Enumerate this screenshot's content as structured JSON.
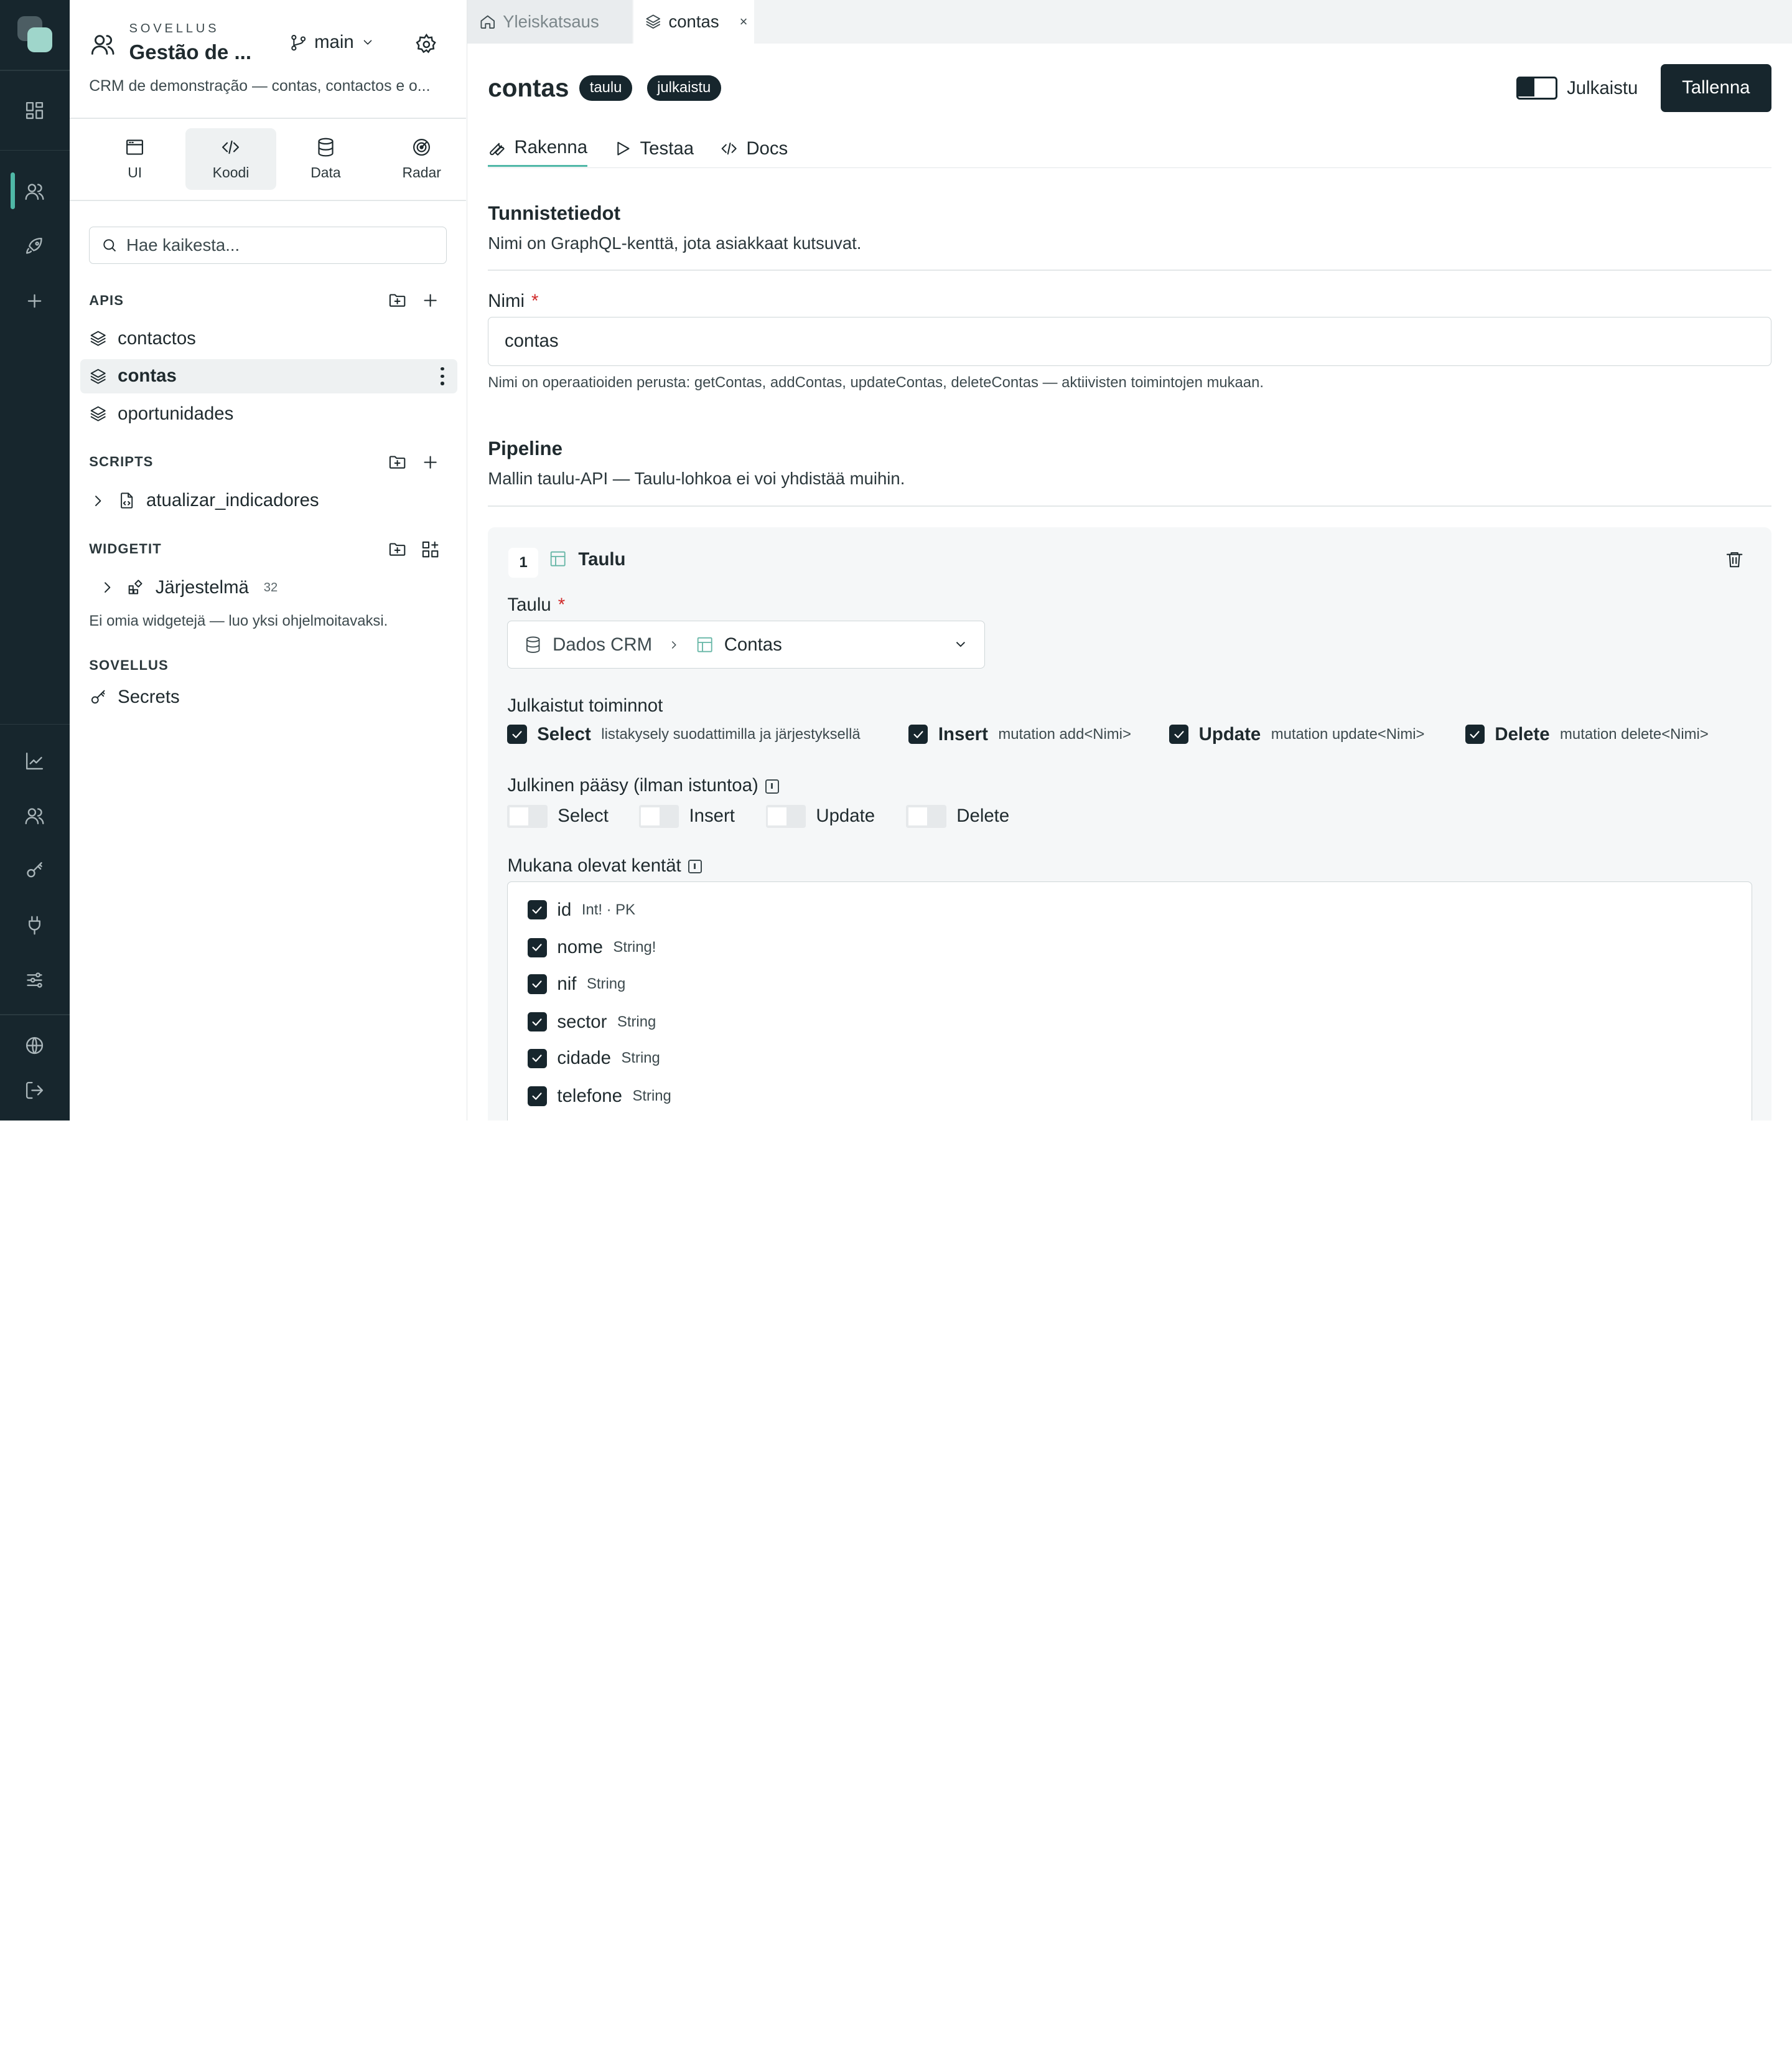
{
  "app": {
    "kicker": "SOVELLUS",
    "name": "Gestão de ...",
    "branch": "main",
    "description": "CRM de demonstração — contas, contactos e o..."
  },
  "rail": {
    "icons": [
      "dashboard-icon",
      "users-icon",
      "rocket-icon",
      "plus-icon",
      "chart-icon",
      "people-icon",
      "key-icon",
      "plug-icon",
      "sliders-icon",
      "globe-icon",
      "logout-icon"
    ],
    "active": "users-icon"
  },
  "modes": [
    {
      "label": "UI",
      "icon": "window-icon"
    },
    {
      "label": "Koodi",
      "icon": "code-icon",
      "active": true
    },
    {
      "label": "Data",
      "icon": "database-icon"
    },
    {
      "label": "Radar",
      "icon": "radar-icon"
    }
  ],
  "search": {
    "placeholder": "Hae kaikesta..."
  },
  "sections": {
    "apis": {
      "title": "APIS",
      "items": [
        "contactos",
        "contas",
        "oportunidades"
      ],
      "selected": "contas"
    },
    "scripts": {
      "title": "SCRIPTS",
      "items": [
        "atualizar_indicadores"
      ]
    },
    "widgets": {
      "title": "WIDGETIT",
      "group": "Järjestelmä",
      "group_count": "32",
      "note": "Ei omia widgetejä — luo yksi ohjelmoitavaksi."
    },
    "app": {
      "title": "SOVELLUS",
      "items": [
        "Secrets"
      ]
    }
  },
  "tabs": [
    {
      "label": "Yleiskatsaus",
      "icon": "home-icon"
    },
    {
      "label": "contas",
      "icon": "layers-icon",
      "close": "×"
    }
  ],
  "header": {
    "title": "contas",
    "badges": [
      "taulu",
      "julkaistu"
    ],
    "publish_label": "Julkaistu",
    "published": true,
    "save_label": "Tallenna"
  },
  "subtabs": [
    {
      "label": "Rakenna",
      "icon": "wrench-icon",
      "active": true
    },
    {
      "label": "Testaa",
      "icon": "play-icon"
    },
    {
      "label": "Docs",
      "icon": "code-icon"
    }
  ],
  "identity": {
    "title": "Tunnistetiedot",
    "desc": "Nimi on GraphQL-kenttä, jota asiakkaat kutsuvat.",
    "name_label": "Nimi",
    "required": "*",
    "name_value": "contas",
    "hint": "Nimi on operaatioiden perusta: getContas, addContas, updateContas, deleteContas — aktiivisten toimintojen mukaan."
  },
  "pipeline": {
    "title": "Pipeline",
    "desc": "Mallin taulu-API — Taulu-lohkoa ei voi yhdistää muihin.",
    "step": {
      "number": "1",
      "title": "Taulu",
      "table_label": "Taulu",
      "required": "*",
      "database": "Dados CRM",
      "table": "Contas",
      "ops_label": "Julkaistut toiminnot",
      "ops": [
        {
          "name": "Select",
          "desc": "listakysely suodattimilla ja järjestyksellä",
          "checked": true
        },
        {
          "name": "Insert",
          "desc": "mutation add<Nimi>",
          "checked": true
        },
        {
          "name": "Update",
          "desc": "mutation update<Nimi>",
          "checked": true
        },
        {
          "name": "Delete",
          "desc": "mutation delete<Nimi>",
          "checked": true
        }
      ],
      "public_label": "Julkinen pääsy (ilman istuntoa)",
      "public": [
        {
          "name": "Select",
          "on": false
        },
        {
          "name": "Insert",
          "on": false
        },
        {
          "name": "Update",
          "on": false
        },
        {
          "name": "Delete",
          "on": false
        }
      ],
      "fields_label": "Mukana olevat kentät",
      "fields": [
        {
          "name": "id",
          "type": "Int! · PK",
          "checked": true
        },
        {
          "name": "nome",
          "type": "String!",
          "checked": true
        },
        {
          "name": "nif",
          "type": "String",
          "checked": true
        },
        {
          "name": "sector",
          "type": "String",
          "checked": true
        },
        {
          "name": "cidade",
          "type": "String",
          "checked": true
        },
        {
          "name": "telefone",
          "type": "String",
          "checked": true
        }
      ]
    }
  }
}
